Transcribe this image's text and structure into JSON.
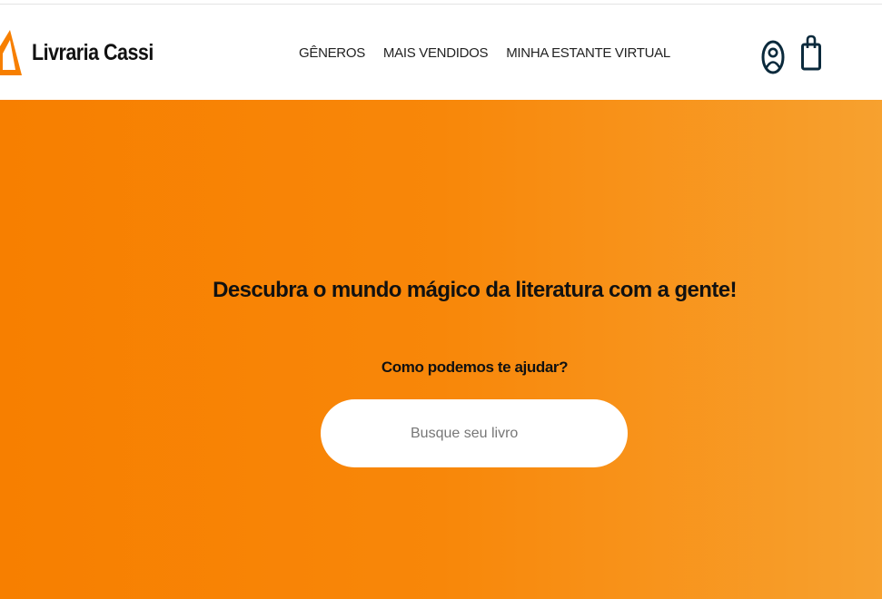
{
  "brand": {
    "name": "Livraria Cassi",
    "accent_color": "#f77f00",
    "icon_color": "#0b2a3c"
  },
  "nav": {
    "items": [
      {
        "label": "GÊNEROS"
      },
      {
        "label": "MAIS VENDIDOS"
      },
      {
        "label": "MINHA ESTANTE VIRTUAL"
      }
    ]
  },
  "header_icons": {
    "account": "user-circle-icon",
    "cart": "shopping-bag-icon"
  },
  "hero": {
    "title": "Descubra o mundo mágico da literatura com a gente!",
    "subtitle": "Como podemos te ajudar?",
    "search_placeholder": "Busque seu livro",
    "search_value": ""
  }
}
